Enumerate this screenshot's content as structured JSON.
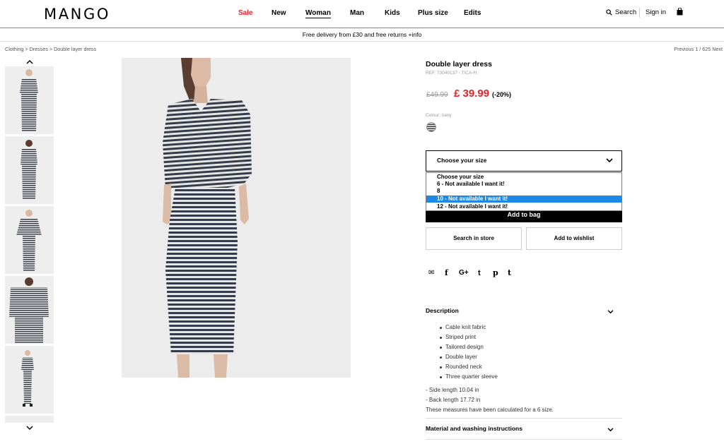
{
  "header": {
    "logo": "MANGO",
    "nav": [
      "Sale",
      "New",
      "Woman",
      "Man",
      "Kids",
      "Plus size",
      "Edits"
    ],
    "search_label": "Search",
    "signin_label": "Sign in"
  },
  "promo": "Free delivery from £30 and free returns +info",
  "breadcrumb": "Clothing > Dresses > Double layer dress",
  "prevnext": "Previous 1 / 625 Next",
  "product": {
    "title": "Double layer dress",
    "ref": "REF. 73040137 - TICA-H",
    "price_old": "£49.99",
    "price_new": "£ 39.99",
    "discount": "(-20%)",
    "colour_label": "Colour: navy",
    "size_placeholder": "Choose your size",
    "size_options": [
      "Choose your size",
      "6 - Not available I want it!",
      "8",
      "10 - Not available I want it!",
      "12 - Not available I want it!"
    ],
    "selected_option_index": 3,
    "add_to_bag": "Add to bag",
    "search_in_store": "Search in store",
    "add_to_wishlist": "Add to wishlist"
  },
  "social_icons": [
    "mail-icon",
    "facebook-icon",
    "google-plus-icon",
    "twitter-icon",
    "pinterest-icon",
    "tumblr-icon"
  ],
  "social_glyphs": [
    "✉",
    "f",
    "G+",
    "t",
    "p",
    "t"
  ],
  "description": {
    "heading": "Description",
    "bullets": [
      "Cable knit fabric",
      "Striped print",
      "Tailored design",
      "Double layer",
      "Rounded neck",
      "Three quarter sleeve"
    ],
    "measure_1": "- Side length 10.04 in",
    "measure_2": "- Back length 17.72 in",
    "measure_note": "These measures have been calculated for a 6 size."
  },
  "material_heading": "Material and washing instructions",
  "colors": {
    "sale": "#e4222c",
    "price": "#e4222c",
    "selected_option": "#1e88e5"
  }
}
